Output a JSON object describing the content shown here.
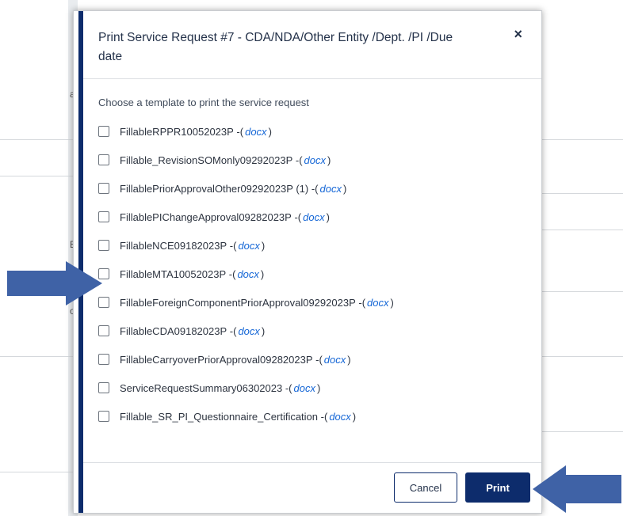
{
  "modal": {
    "title": "Print Service Request #7 - CDA/NDA/Other Entity /Dept. /PI /Due date",
    "close_symbol": "×",
    "intro": "Choose a template to print the service request",
    "templates": [
      {
        "name": "FillableRPPR10052023P",
        "ext": "docx"
      },
      {
        "name": "Fillable_RevisionSOMonly09292023P",
        "ext": "docx"
      },
      {
        "name": "FillablePriorApprovalOther09292023P (1)",
        "ext": "docx"
      },
      {
        "name": "FillablePIChangeApproval09282023P",
        "ext": "docx"
      },
      {
        "name": "FillableNCE09182023P",
        "ext": "docx"
      },
      {
        "name": "FillableMTA10052023P",
        "ext": "docx"
      },
      {
        "name": "FillableForeignComponentPriorApproval09292023P",
        "ext": "docx"
      },
      {
        "name": "FillableCDA09182023P",
        "ext": "docx"
      },
      {
        "name": "FillableCarryoverPriorApproval09282023P",
        "ext": "docx"
      },
      {
        "name": "ServiceRequestSummary06302023",
        "ext": "docx"
      },
      {
        "name": "Fillable_SR_PI_Questionnaire_Certification",
        "ext": "docx"
      }
    ],
    "sep_open": " -(",
    "sep_close": ")",
    "cancel_label": "Cancel",
    "print_label": "Print"
  },
  "colors": {
    "accent": "#0d2c6c",
    "link": "#1466d6",
    "arrow": "#3f62a6"
  },
  "icons": {
    "close": "close-icon",
    "arrow": "arrow-annotation-icon"
  },
  "background": {
    "glyphs": [
      "al",
      "E",
      "o"
    ]
  }
}
